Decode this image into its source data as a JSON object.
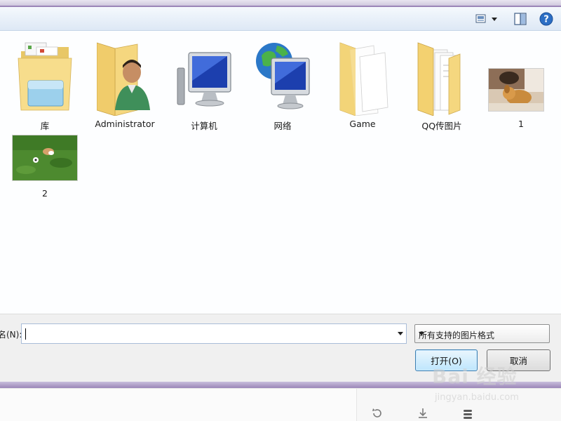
{
  "files": [
    {
      "label": "库",
      "kind": "library-folder"
    },
    {
      "label": "Administrator",
      "kind": "user-folder"
    },
    {
      "label": "计算机",
      "kind": "computer"
    },
    {
      "label": "网络",
      "kind": "network"
    },
    {
      "label": "Game",
      "kind": "folder-papers"
    },
    {
      "label": "QQ传图片",
      "kind": "folder-docs"
    },
    {
      "label": "1",
      "kind": "image-dogs"
    },
    {
      "label": "2",
      "kind": "image-grass-dog"
    }
  ],
  "filename": {
    "label": "名(N):",
    "value": ""
  },
  "filter": {
    "selected": "所有支持的图片格式"
  },
  "buttons": {
    "open": "打开(O)",
    "cancel": "取消"
  },
  "watermark": {
    "text": "Bai 经验",
    "sub": "jingyan.baidu.com"
  },
  "colors": {
    "frame_accent": "#9b86b8",
    "toolbar": "#dde8f5",
    "primary_button": "#bee6fd",
    "help_icon": "#2c6ec4"
  },
  "icons": [
    "views-icon",
    "chevron-down-icon",
    "preview-pane-icon",
    "help-icon",
    "refresh-icon",
    "download-icon",
    "stack-icon"
  ]
}
